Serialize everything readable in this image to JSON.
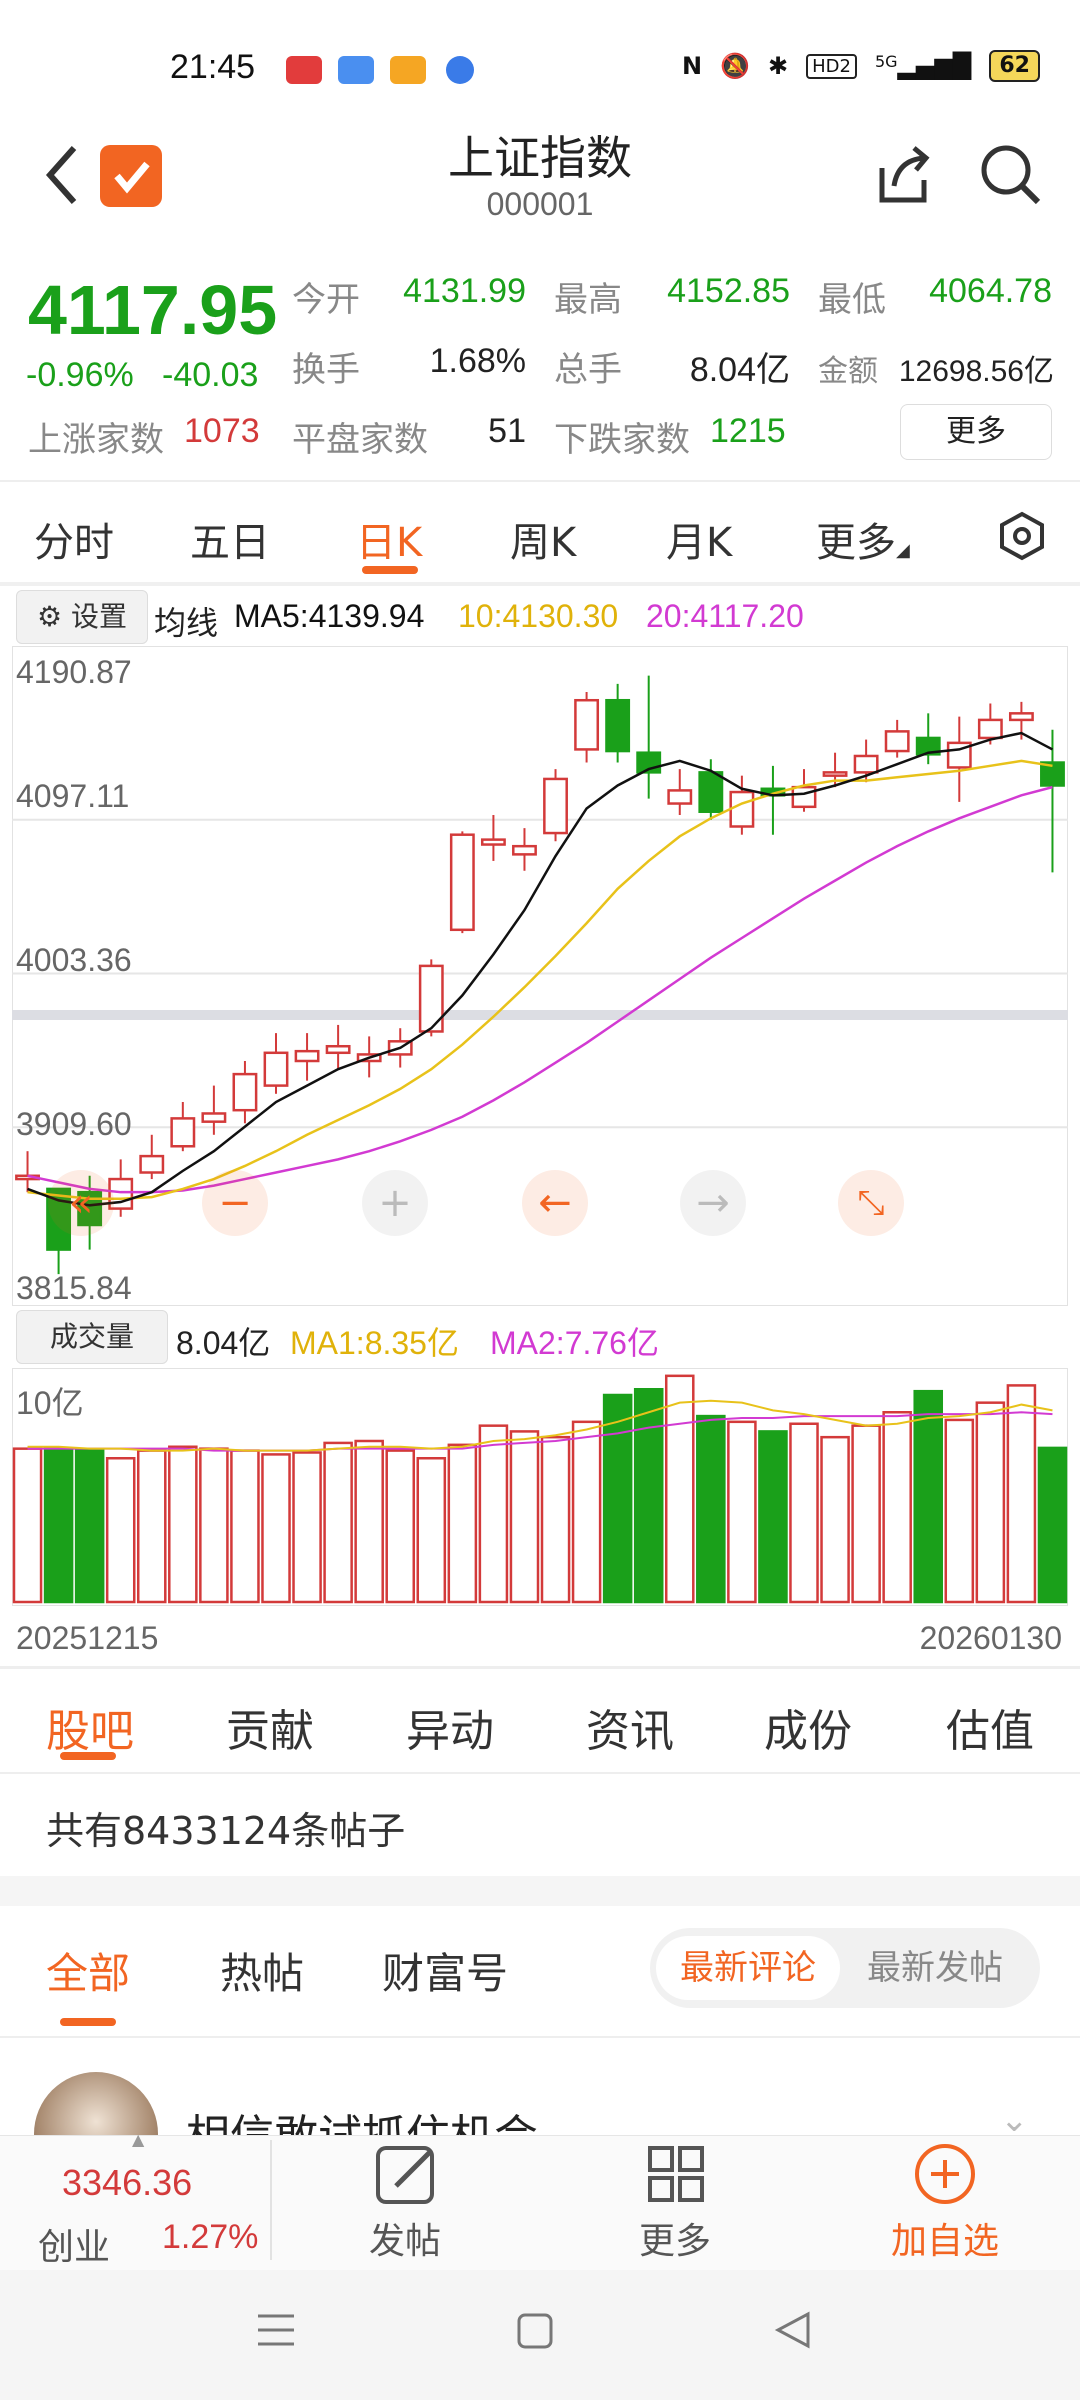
{
  "status_bar": {
    "time": "21:45",
    "battery": "62",
    "network": "5G",
    "hd": "HD2"
  },
  "header": {
    "title": "上证指数",
    "code": "000001"
  },
  "quote": {
    "price": "4117.95",
    "change_pct": "-0.96%",
    "change_val": "-40.03",
    "open_label": "今开",
    "open": "4131.99",
    "high_label": "最高",
    "high": "4152.85",
    "low_label": "最低",
    "low": "4064.78",
    "turnover_label": "换手",
    "turnover": "1.68%",
    "volume_label": "总手",
    "volume": "8.04亿",
    "amount_label": "金额",
    "amount": "12698.56亿",
    "up_label": "上涨家数",
    "up": "1073",
    "flat_label": "平盘家数",
    "flat": "51",
    "down_label": "下跌家数",
    "down": "1215",
    "more": "更多"
  },
  "kline_tabs": [
    "分时",
    "五日",
    "日K",
    "周K",
    "月K",
    "更多"
  ],
  "kline_active": 2,
  "chart_settings": "设置",
  "ma_legend": {
    "label": "均线",
    "ma5": "MA5:4139.94",
    "ma10": "10:4130.30",
    "ma20": "20:4117.20"
  },
  "volume_legend": {
    "button": "成交量",
    "value": "8.04亿",
    "ma1": "MA1:8.35亿",
    "ma2": "MA2:7.76亿"
  },
  "volume_axis_top": "10亿",
  "date_start": "20251215",
  "date_end": "20260130",
  "colors": {
    "up": "#d33a3a",
    "down": "#1aa01a",
    "ma5": "#111111",
    "ma10": "#e8c21a",
    "ma20": "#d23ad2",
    "accent": "#f26522"
  },
  "chart_data": {
    "type": "candlestick",
    "yticks": [
      "4190.87",
      "4097.11",
      "4003.36",
      "3909.60",
      "3815.84"
    ],
    "ylim": [
      3815.84,
      4190.87
    ],
    "candles": [
      {
        "o": 3878,
        "c": 3880,
        "h": 3895,
        "l": 3870
      },
      {
        "o": 3872,
        "c": 3835,
        "h": 3872,
        "l": 3820
      },
      {
        "o": 3870,
        "c": 3850,
        "h": 3880,
        "l": 3835
      },
      {
        "o": 3860,
        "c": 3878,
        "h": 3890,
        "l": 3855
      },
      {
        "o": 3882,
        "c": 3892,
        "h": 3905,
        "l": 3878
      },
      {
        "o": 3898,
        "c": 3915,
        "h": 3925,
        "l": 3895
      },
      {
        "o": 3913,
        "c": 3918,
        "h": 3935,
        "l": 3905
      },
      {
        "o": 3920,
        "c": 3942,
        "h": 3950,
        "l": 3912
      },
      {
        "o": 3935,
        "c": 3955,
        "h": 3967,
        "l": 3930
      },
      {
        "o": 3950,
        "c": 3956,
        "h": 3967,
        "l": 3938
      },
      {
        "o": 3955,
        "c": 3959,
        "h": 3972,
        "l": 3945
      },
      {
        "o": 3950,
        "c": 3954,
        "h": 3965,
        "l": 3940
      },
      {
        "o": 3954,
        "c": 3962,
        "h": 3970,
        "l": 3946
      },
      {
        "o": 3968,
        "c": 4008,
        "h": 4012,
        "l": 3965
      },
      {
        "o": 4030,
        "c": 4088,
        "h": 4090,
        "l": 4028
      },
      {
        "o": 4082,
        "c": 4085,
        "h": 4100,
        "l": 4072
      },
      {
        "o": 4076,
        "c": 4081,
        "h": 4092,
        "l": 4066
      },
      {
        "o": 4089,
        "c": 4122,
        "h": 4128,
        "l": 4084
      },
      {
        "o": 4140,
        "c": 4170,
        "h": 4175,
        "l": 4132
      },
      {
        "o": 4170,
        "c": 4139,
        "h": 4180,
        "l": 4132
      },
      {
        "o": 4138,
        "c": 4126,
        "h": 4185,
        "l": 4110
      },
      {
        "o": 4107,
        "c": 4115,
        "h": 4128,
        "l": 4100
      },
      {
        "o": 4126,
        "c": 4102,
        "h": 4134,
        "l": 4097
      },
      {
        "o": 4093,
        "c": 4114,
        "h": 4124,
        "l": 4088
      },
      {
        "o": 4116,
        "c": 4112,
        "h": 4130,
        "l": 4088
      },
      {
        "o": 4105,
        "c": 4117,
        "h": 4128,
        "l": 4102
      },
      {
        "o": 4124,
        "c": 4126,
        "h": 4138,
        "l": 4117
      },
      {
        "o": 4126,
        "c": 4136,
        "h": 4146,
        "l": 4120
      },
      {
        "o": 4139,
        "c": 4151,
        "h": 4158,
        "l": 4135
      },
      {
        "o": 4147,
        "c": 4137,
        "h": 4162,
        "l": 4131
      },
      {
        "o": 4129,
        "c": 4144,
        "h": 4160,
        "l": 4108
      },
      {
        "o": 4147,
        "c": 4158,
        "h": 4168,
        "l": 4143
      },
      {
        "o": 4158,
        "c": 4162,
        "h": 4169,
        "l": 4146
      },
      {
        "o": 4132,
        "c": 4118,
        "h": 4152,
        "l": 4065
      }
    ],
    "ma5": [
      3872,
      3865,
      3862,
      3864,
      3870,
      3883,
      3895,
      3910,
      3925,
      3935,
      3945,
      3952,
      3958,
      3970,
      3990,
      4015,
      4042,
      4075,
      4104,
      4118,
      4128,
      4133,
      4127,
      4116,
      4112,
      4113,
      4118,
      4124,
      4131,
      4138,
      4140,
      4146,
      4150,
      4140
    ],
    "ma10": [
      3870,
      3868,
      3866,
      3866,
      3867,
      3872,
      3878,
      3886,
      3895,
      3905,
      3914,
      3923,
      3933,
      3945,
      3960,
      3977,
      3995,
      4014,
      4034,
      4055,
      4072,
      4087,
      4098,
      4107,
      4113,
      4118,
      4121,
      4121,
      4123,
      4125,
      4127,
      4130,
      4133,
      4130
    ],
    "ma20": [
      3880,
      3876,
      3872,
      3870,
      3870,
      3871,
      3874,
      3878,
      3882,
      3886,
      3890,
      3895,
      3901,
      3908,
      3916,
      3926,
      3937,
      3949,
      3961,
      3974,
      3987,
      4000,
      4013,
      4025,
      4037,
      4049,
      4060,
      4071,
      4081,
      4090,
      4098,
      4105,
      4112,
      4117
    ],
    "volumes": [
      8.0,
      8.0,
      7.9,
      7.5,
      7.9,
      8.1,
      8.0,
      7.9,
      7.7,
      7.8,
      8.3,
      8.4,
      7.9,
      7.5,
      8.2,
      9.2,
      8.9,
      8.6,
      9.4,
      10.8,
      11.1,
      11.8,
      9.7,
      9.4,
      8.9,
      9.3,
      8.6,
      9.2,
      9.9,
      11.0,
      9.5,
      10.4,
      11.3,
      8.04
    ],
    "vol_ma1": [
      8.1,
      8.1,
      8.0,
      8.0,
      7.9,
      7.9,
      8.0,
      7.9,
      7.9,
      7.9,
      8.0,
      8.1,
      8.1,
      8.0,
      8.1,
      8.4,
      8.5,
      8.7,
      9.0,
      9.4,
      9.9,
      10.4,
      10.5,
      10.4,
      10.0,
      9.8,
      9.5,
      9.2,
      9.3,
      9.6,
      9.7,
      9.9,
      10.3,
      10.0
    ],
    "vol_ma2": [
      8.0,
      8.0,
      8.0,
      8.0,
      8.0,
      8.0,
      7.9,
      7.9,
      7.9,
      7.9,
      8.0,
      8.0,
      8.0,
      8.0,
      8.0,
      8.2,
      8.3,
      8.4,
      8.6,
      8.8,
      9.1,
      9.3,
      9.5,
      9.6,
      9.6,
      9.7,
      9.7,
      9.7,
      9.7,
      9.8,
      9.8,
      9.8,
      9.9,
      9.8
    ],
    "vol_max": 12.0
  },
  "community_tabs": [
    "股吧",
    "贡献",
    "异动",
    "资讯",
    "成份",
    "估值"
  ],
  "community_active": 0,
  "post_count_text": "共有8433124条帖子",
  "filter_tabs": [
    "全部",
    "热帖",
    "财富号"
  ],
  "filter_active": 0,
  "sort_seg": [
    "最新评论",
    "最新发帖"
  ],
  "post_preview": "相信敢试抓住机会",
  "bottom_bar": {
    "index_value": "3346.36",
    "index_name": "创业",
    "index_change": "1.27%",
    "post": "发帖",
    "more": "更多",
    "add": "加自选"
  }
}
